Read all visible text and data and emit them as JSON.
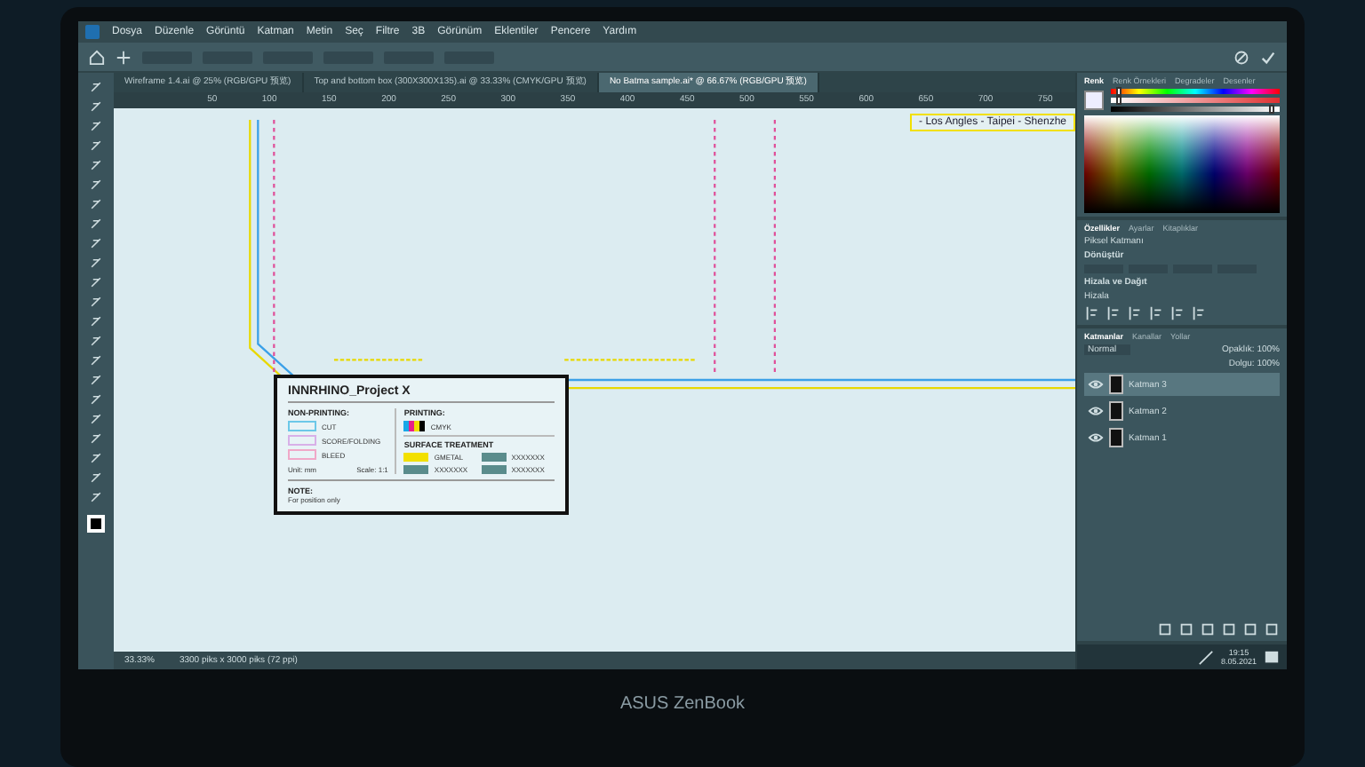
{
  "menu": [
    "Dosya",
    "Düzenle",
    "Görüntü",
    "Katman",
    "Metin",
    "Seç",
    "Filtre",
    "3B",
    "Görünüm",
    "Eklentiler",
    "Pencere",
    "Yardım"
  ],
  "tabs": [
    {
      "label": "Wireframe 1.4.ai @ 25% (RGB/GPU 预览)",
      "selected": false
    },
    {
      "label": "Top and bottom box (300X300X135).ai @ 33.33% (CMYK/GPU 预览)",
      "selected": false
    },
    {
      "label": "No Batma sample.ai* @ 66.67% (RGB/GPU 预览)",
      "selected": true
    }
  ],
  "ruler": [
    "50",
    "100",
    "150",
    "200",
    "250",
    "300",
    "350",
    "400",
    "450",
    "500",
    "550",
    "600",
    "650",
    "700",
    "750"
  ],
  "canvas": {
    "header_text": "- Los Angles - Taipei - Shenzhe",
    "legend": {
      "title": "INNRHINO_Project X",
      "non_printing_label": "NON-PRINTING:",
      "non_printing": [
        {
          "label": "CUT",
          "color": "#6cc8e8"
        },
        {
          "label": "SCORE/FOLDING",
          "color": "#d8b0e8"
        },
        {
          "label": "BLEED",
          "color": "#f0a8c8"
        }
      ],
      "printing_label": "PRINTING:",
      "printing_text": "CMYK",
      "surface_label": "SURFACE TREATMENT",
      "surface": [
        {
          "label": "GMETAL",
          "color": "#f2e000"
        },
        {
          "label": "XXXXXXX",
          "color": "#5a8c8c"
        },
        {
          "label": "XXXXXXX",
          "color": "#5a8c8c"
        },
        {
          "label": "XXXXXXX",
          "color": "#5a8c8c"
        }
      ],
      "unit": "Unit: mm",
      "scale": "Scale: 1:1",
      "note_label": "NOTE:",
      "note": "For position only"
    }
  },
  "color_panel": {
    "tabs": [
      {
        "label": "Renk",
        "selected": true
      },
      {
        "label": "Renk Örnekleri",
        "selected": false
      },
      {
        "label": "Degradeler",
        "selected": false
      },
      {
        "label": "Desenler",
        "selected": false
      }
    ],
    "sliders": [
      {
        "kind": "hue",
        "level": 0.05
      },
      {
        "kind": "saturation",
        "level": 0.05
      },
      {
        "kind": "brightness",
        "level": 0.95
      }
    ]
  },
  "properties_panel": {
    "tabs": [
      {
        "label": "Özellikler",
        "selected": true
      },
      {
        "label": "Ayarlar",
        "selected": false
      },
      {
        "label": "Kitaplıklar",
        "selected": false
      }
    ],
    "layer_type": "Piksel Katmanı",
    "transform": "Dönüştür",
    "align": "Hizala ve Dağıt",
    "align_label": "Hizala"
  },
  "layers_panel": {
    "tabs": [
      {
        "label": "Katmanlar",
        "selected": true
      },
      {
        "label": "Kanallar",
        "selected": false
      },
      {
        "label": "Yollar",
        "selected": false
      }
    ],
    "blend": "Normal",
    "opacity": "Opaklık: 100%",
    "fill": "Dolgu: 100%",
    "layers": [
      {
        "name": "Katman 3",
        "selected": true
      },
      {
        "name": "Katman 2",
        "selected": false
      },
      {
        "name": "Katman 1",
        "selected": false
      }
    ]
  },
  "status_bar": {
    "zoom": "33.33%",
    "size": "3300 piks x 3000 piks (72 ppi)"
  },
  "taskbar": {
    "time": "19:15",
    "date": "8.05.2021"
  },
  "brand": "ASUS ZenBook"
}
